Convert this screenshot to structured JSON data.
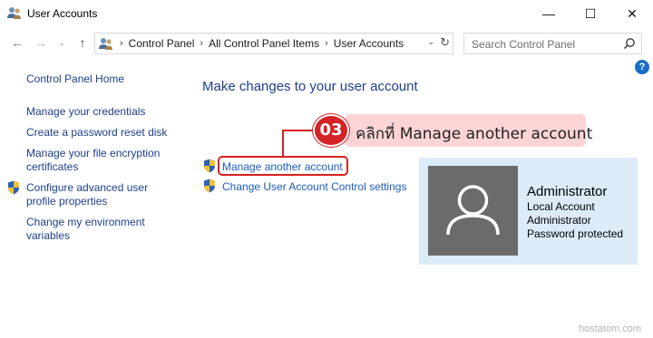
{
  "window": {
    "title": "User Accounts",
    "icon": "user-accounts-icon",
    "minimize_glyph": "—",
    "maximize_glyph": "☐",
    "close_glyph": "✕"
  },
  "nav": {
    "back_glyph": "←",
    "forward_glyph": "→",
    "recent_glyph": "⌄",
    "up_glyph": "↑",
    "breadcrumbs": [
      "Control Panel",
      "All Control Panel Items",
      "User Accounts"
    ],
    "separator": "›",
    "dropdown_glyph": "⌄",
    "refresh_glyph": "↻"
  },
  "search": {
    "placeholder": "Search Control Panel"
  },
  "help_label": "?",
  "sidebar": {
    "items": [
      {
        "label": "Control Panel Home"
      },
      {
        "label": "Manage your credentials"
      },
      {
        "label": "Create a password reset disk"
      },
      {
        "label": "Manage your file encryption certificates"
      },
      {
        "label": "Configure advanced user profile properties",
        "icon": "shield-icon"
      },
      {
        "label": "Change my environment variables"
      }
    ]
  },
  "main": {
    "heading": "Make changes to your user account",
    "tasks": [
      {
        "label": "Manage another account",
        "icon": "shield-icon"
      },
      {
        "label": "Change User Account Control settings",
        "icon": "shield-icon"
      }
    ]
  },
  "callout": {
    "step": "03",
    "text": "คลิกที่ Manage another account",
    "color": "#d42326",
    "banner_color": "#fcd4d6"
  },
  "account": {
    "name": "Administrator",
    "lines": [
      "Local Account",
      "Administrator",
      "Password protected"
    ],
    "card_color": "#dcebf8"
  },
  "watermark": "hostatom.com"
}
